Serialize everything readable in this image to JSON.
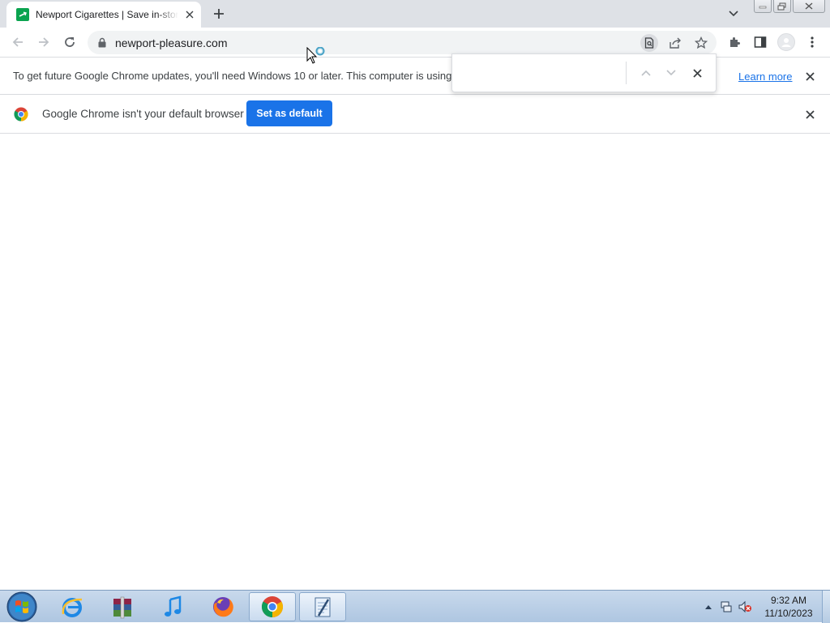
{
  "browser": {
    "tab": {
      "title": "Newport Cigarettes | Save in-store",
      "favicon": "newport-favicon"
    },
    "omnibox": {
      "url": "newport-pleasure.com"
    },
    "toolbar_icons": [
      "back-icon",
      "forward-icon",
      "reload-icon",
      "lock-icon",
      "find-in-page-icon",
      "share-icon",
      "bookmark-star-icon",
      "extensions-icon",
      "side-panel-icon",
      "profile-icon",
      "menu-icon"
    ]
  },
  "infobars": {
    "update": {
      "message": "To get future Google Chrome updates, you'll need Windows 10 or later. This computer is using",
      "link": "Learn more"
    },
    "default_browser": {
      "message": "Google Chrome isn't your default browser",
      "button": "Set as default"
    }
  },
  "findbar": {
    "query": "",
    "placeholder": ""
  },
  "taskbar": {
    "apps": [
      "internet-explorer",
      "winrar",
      "itunes",
      "firefox",
      "chrome",
      "notepad"
    ],
    "clock": {
      "time": "9:32 AM",
      "date": "11/10/2023"
    }
  },
  "colors": {
    "accent": "#1a73e8",
    "tab_strip": "#dee1e6",
    "omnibox": "#f1f3f4",
    "newport_green": "#0aa34f"
  }
}
